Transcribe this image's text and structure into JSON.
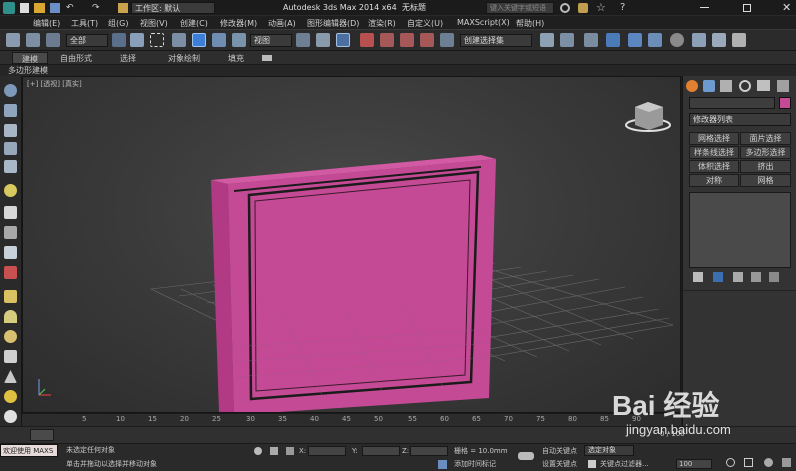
{
  "app": {
    "title": "Autodesk 3ds Max  2014 x64",
    "document": "无标题",
    "workspace": "工作区: 默认",
    "search_placeholder": "键入关键字或短语"
  },
  "menu": [
    "编辑(E)",
    "工具(T)",
    "组(G)",
    "视图(V)",
    "创建(C)",
    "修改器(M)",
    "动画(A)",
    "图形编辑器(D)",
    "渲染(R)",
    "自定义(U)",
    "MAXScript(X)",
    "帮助(H)"
  ],
  "toolbar": {
    "selection_filter": "全部",
    "ref_coord": "视图",
    "named_selection": "创建选择集"
  },
  "ribbon": {
    "tabs": [
      "建模",
      "自由形式",
      "选择",
      "对象绘制",
      "填充"
    ],
    "sub": "多边形建模"
  },
  "viewport": {
    "label": "[+] [透视] [真实]"
  },
  "command_panel": {
    "modifier_list": "修改器列表",
    "buttons": [
      "网格选择",
      "面片选择",
      "样条线选择",
      "多边形选择",
      "体积选择",
      "挤出",
      "对称",
      "网格"
    ]
  },
  "timeline": {
    "ticks": [
      "5",
      "10",
      "15",
      "20",
      "25",
      "30",
      "35",
      "40",
      "45",
      "50",
      "55",
      "60",
      "65",
      "70",
      "75",
      "80",
      "85",
      "90"
    ],
    "frame": "0 / 100"
  },
  "status": {
    "welcome": "欢迎使用 MAXS",
    "no_selection": "未选定任何对象",
    "prompt": "单击并拖动以选择并移动对象",
    "x_label": "X:",
    "y_label": "Y:",
    "z_label": "Z:",
    "grid": "栅格 = 10.0mm",
    "add_time_tag": "添加时间标记",
    "auto_key": "自动关键点",
    "set_key": "设置关键点",
    "selected": "选定对象",
    "key_filters": "关键点过滤器...",
    "frame_value": "100"
  },
  "colors": {
    "object": "#c54a95",
    "accent": "#e06030"
  },
  "watermark": {
    "text": "Bai 经验",
    "url": "jingyan.baidu.com"
  }
}
